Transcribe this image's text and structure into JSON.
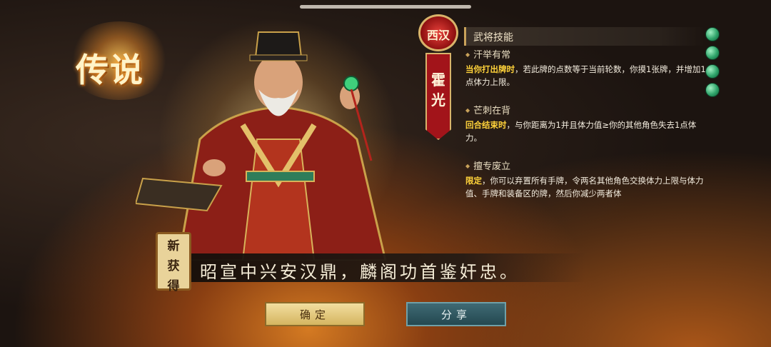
{
  "rarity_label": "传说",
  "dynasty": "西汉",
  "general_name": "霍光",
  "skills_header": "武将技能",
  "skills": [
    {
      "name": "汗举有常",
      "highlight": "当你打出牌时",
      "desc": "，若此牌的点数等于当前轮数，你摸1张牌，并增加1点体力上限。"
    },
    {
      "name": "芒刺在背",
      "highlight": "回合结束时",
      "desc": "，与你距离为1并且体力值≥你的其他角色失去1点体力。"
    },
    {
      "name": "擅专废立",
      "highlight": "限定",
      "desc": "，你可以弃置所有手牌，令两名其他角色交换体力上限与体力值、手牌和装备区的牌，然后你减少两者体"
    }
  ],
  "new_tag": [
    "新",
    "获",
    "得"
  ],
  "motto": "昭宣中兴安汉鼎，麟阁功首鉴奸忠。",
  "buttons": {
    "confirm": "确定",
    "share": "分享"
  },
  "colors": {
    "highlight": "#ffd23a",
    "dynasty_red": "#a2141a",
    "confirm_bg": "#e6cd80",
    "share_bg": "#2f5a63"
  },
  "icons": [
    "jade-charm-icon",
    "jade-charm-icon",
    "jade-charm-icon",
    "jade-charm-icon"
  ]
}
